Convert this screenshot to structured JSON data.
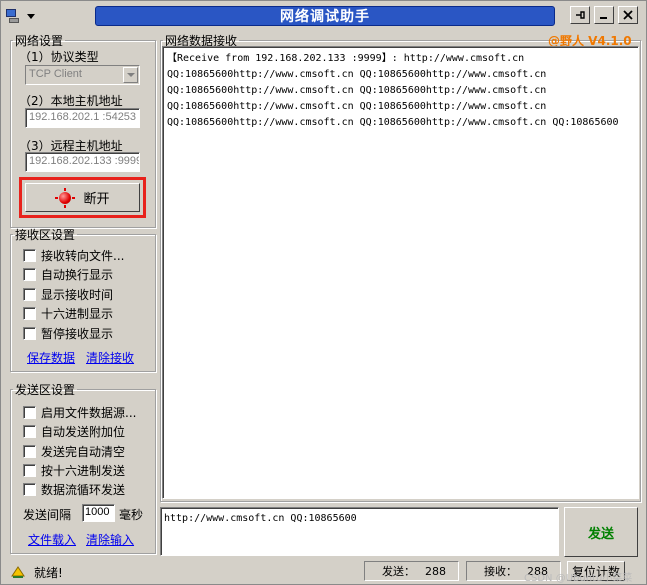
{
  "window": {
    "title": "网络调试助手",
    "version": "@野人 V4.1.0"
  },
  "network": {
    "group_label": "网络设置",
    "protocol_label": "（1）协议类型",
    "protocol_value": "TCP Client",
    "local_label": "（2）本地主机地址",
    "local_value": "192.168.202.1 :54253",
    "remote_label": "（3）远程主机地址",
    "remote_value": "192.168.202.133 :9999",
    "connect_label": "断开"
  },
  "receive_settings": {
    "group_label": "接收区设置",
    "options": [
      "接收转向文件...",
      "自动换行显示",
      "显示接收时间",
      "十六进制显示",
      "暂停接收显示"
    ],
    "save_link": "保存数据",
    "clear_link": "清除接收"
  },
  "send_settings": {
    "group_label": "发送区设置",
    "options": [
      "启用文件数据源...",
      "自动发送附加位",
      "发送完自动清空",
      "按十六进制发送",
      "数据流循环发送"
    ],
    "interval_label": "发送间隔",
    "interval_value": "1000",
    "interval_unit": "毫秒",
    "load_link": "文件载入",
    "clear_link": "清除输入"
  },
  "receive_area": {
    "label": "网络数据接收",
    "lines": [
      "【Receive from 192.168.202.133 :9999】: http://www.cmsoft.cn",
      "QQ:10865600http://www.cmsoft.cn QQ:10865600http://www.cmsoft.cn",
      "QQ:10865600http://www.cmsoft.cn QQ:10865600http://www.cmsoft.cn",
      "QQ:10865600http://www.cmsoft.cn QQ:10865600http://www.cmsoft.cn",
      "QQ:10865600http://www.cmsoft.cn QQ:10865600http://www.cmsoft.cn QQ:10865600"
    ]
  },
  "send_area": {
    "text": "http://www.cmsoft.cn QQ:10865600",
    "send_label": "发送"
  },
  "status": {
    "text": "就绪!",
    "sent_label": "发送：",
    "sent_count": "288",
    "recv_label": "接收：",
    "recv_count": "288",
    "reset_label": "复位计数"
  },
  "watermark": "CSDN @Ubuntu小菜菜",
  "icons": {
    "app": "network-tool-icon",
    "status": "ready-icon",
    "connect": "red-led-icon"
  }
}
